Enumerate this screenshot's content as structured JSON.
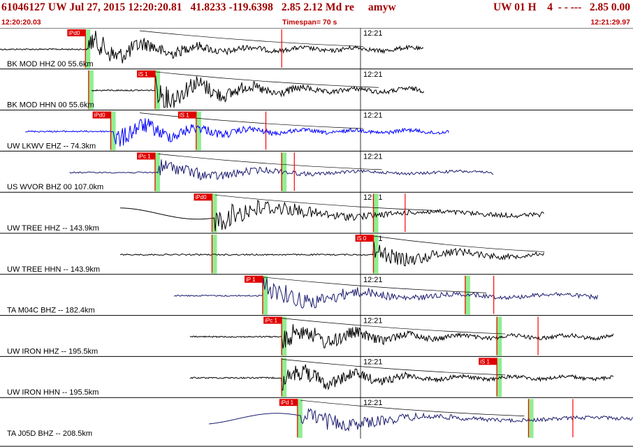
{
  "header": {
    "event_id": "61046127",
    "network": "UW",
    "date": "Jul 27, 2015",
    "time": "12:20:20.81",
    "lat": "41.8233",
    "lon": "-119.6398",
    "depth": "2.85",
    "magnitude": "2.12",
    "mag_type": "Md",
    "review": "re",
    "author": "amyw",
    "title_left": "61046127 UW Jul 27, 2015 12:20:20.81   41.8233 -119.6398   2.85 2.12 Md re     amyw",
    "title_right": "UW 01 H    4  - - ---   2.85 0.00"
  },
  "time_bar": {
    "start": "12:20:20.03",
    "timespan": "Timespan=  70 s",
    "end": "12:21:29.97"
  },
  "colors": {
    "header_text": "#a00000",
    "trace_default": "#000000",
    "trace_blue": "#0000ff",
    "trace_navy": "#1a1a6e",
    "pick_flag": "#ff0000",
    "green_marker": "#90ee90"
  },
  "panels": [
    {
      "label": "BK MOD HHZ 00 55.6km",
      "minute_mark": "12:21",
      "color": "#000000",
      "start": 0.0,
      "end": 0.67,
      "onset": 0.14,
      "amp": 0.8,
      "freq": "high",
      "picks": [
        {
          "t": 0.135,
          "label": "iPd0",
          "green": true
        },
        {
          "t": 0.445,
          "label": "",
          "green": false
        }
      ]
    },
    {
      "label": "BK MOD HHN 00 55.6km",
      "minute_mark": "12:21",
      "color": "#000000",
      "start": 0.145,
      "end": 0.67,
      "onset": 0.245,
      "amp": 0.85,
      "freq": "high",
      "picks": [
        {
          "t": 0.14,
          "label": "",
          "green": true
        },
        {
          "t": 0.245,
          "label": "iS 1",
          "green": true
        }
      ]
    },
    {
      "label": "UW LKWV EHZ -- 74.3km",
      "minute_mark": "12:21",
      "color": "#0000ff",
      "start": 0.04,
      "end": 0.71,
      "onset": 0.18,
      "amp": 0.7,
      "freq": "high",
      "picks": [
        {
          "t": 0.175,
          "label": "iPd0",
          "green": true
        },
        {
          "t": 0.31,
          "label": "iS 1",
          "green": true
        },
        {
          "t": 0.42,
          "label": "",
          "green": false
        }
      ]
    },
    {
      "label": "US WVOR BHZ 00 107.0km",
      "minute_mark": "12:21",
      "color": "#1a1a6e",
      "start": 0.11,
      "end": 0.78,
      "onset": 0.25,
      "amp": 0.55,
      "freq": "mid",
      "picks": [
        {
          "t": 0.245,
          "label": "iPc 1",
          "green": true
        },
        {
          "t": 0.445,
          "label": "",
          "green": true
        },
        {
          "t": 0.465,
          "label": "",
          "green": false
        }
      ]
    },
    {
      "label": "UW TREE HHZ -- 143.9km",
      "minute_mark": "12:21",
      "color": "#000000",
      "start": 0.19,
      "end": 0.86,
      "onset": 0.34,
      "amp": 0.9,
      "freq": "low",
      "picks": [
        {
          "t": 0.335,
          "label": "iPd0",
          "green": true
        },
        {
          "t": 0.59,
          "label": "",
          "green": true
        },
        {
          "t": 0.64,
          "label": "",
          "green": false
        }
      ]
    },
    {
      "label": "UW TREE HHN -- 143.9km",
      "minute_mark": "12:21",
      "color": "#000000",
      "start": 0.19,
      "end": 0.86,
      "onset": 0.59,
      "amp": 0.6,
      "freq": "mid",
      "picks": [
        {
          "t": 0.335,
          "label": "",
          "green": true
        },
        {
          "t": 0.59,
          "label": "iS 0",
          "green": true
        }
      ]
    },
    {
      "label": "TA M04C BHZ -- 182.4km",
      "minute_mark": "12:21",
      "color": "#1a1a6e",
      "start": 0.275,
      "end": 0.945,
      "onset": 0.415,
      "amp": 0.8,
      "freq": "mid",
      "picks": [
        {
          "t": 0.415,
          "label": "iP 1",
          "green": true
        },
        {
          "t": 0.735,
          "label": "",
          "green": true
        },
        {
          "t": 0.78,
          "label": "",
          "green": false
        }
      ]
    },
    {
      "label": "UW IRON HHZ -- 195.5km",
      "minute_mark": "12:21",
      "color": "#000000",
      "start": 0.3,
      "end": 0.97,
      "onset": 0.445,
      "amp": 0.75,
      "freq": "high",
      "picks": [
        {
          "t": 0.445,
          "label": "iPc 1",
          "green": true
        },
        {
          "t": 0.785,
          "label": "",
          "green": true
        },
        {
          "t": 0.85,
          "label": "",
          "green": false
        }
      ]
    },
    {
      "label": "UW IRON HHN -- 195.5km",
      "minute_mark": "12:21",
      "color": "#000000",
      "start": 0.3,
      "end": 0.97,
      "onset": 0.445,
      "amp": 0.7,
      "freq": "high",
      "picks": [
        {
          "t": 0.445,
          "label": "",
          "green": true
        },
        {
          "t": 0.785,
          "label": "iS 1",
          "green": true
        }
      ]
    },
    {
      "label": "TA J05D BHZ -- 208.5km",
      "minute_mark": "12:21",
      "color": "#1a1a6e",
      "start": 0.33,
      "end": 1.0,
      "onset": 0.475,
      "amp": 0.7,
      "freq": "low",
      "picks": [
        {
          "t": 0.47,
          "label": "iPd 1",
          "green": true
        },
        {
          "t": 0.835,
          "label": "",
          "green": true
        },
        {
          "t": 0.905,
          "label": "",
          "green": false
        }
      ]
    }
  ]
}
